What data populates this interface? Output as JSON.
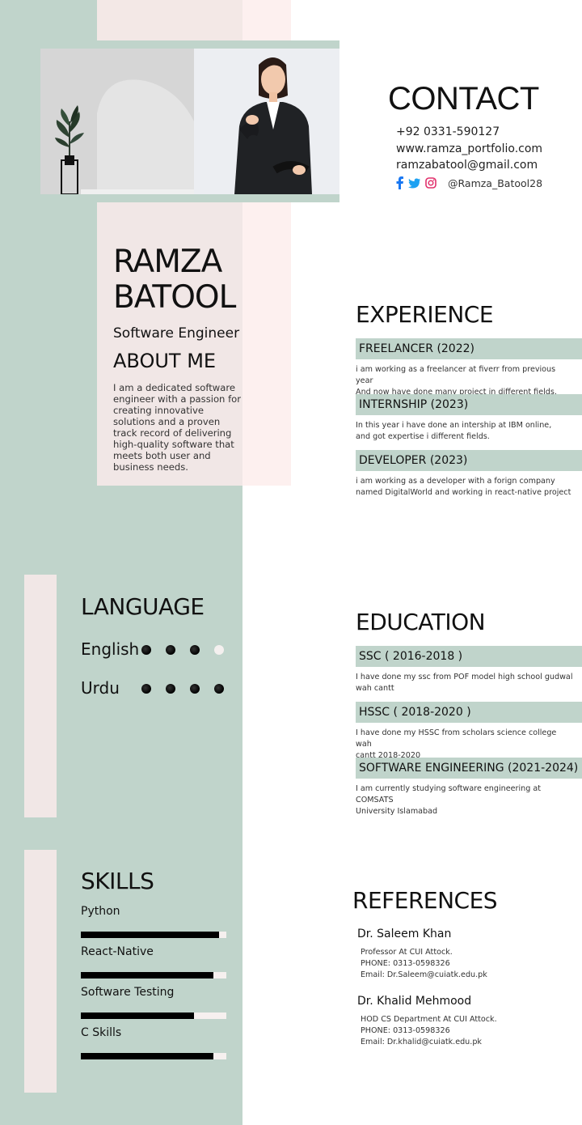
{
  "contact": {
    "title": "CONTACT",
    "phone": "+92 0331-590127",
    "website": "www.ramza_portfolio.com",
    "email": "ramzabatool@gmail.com",
    "social_handle": "@Ramza_Batool28",
    "social_icons": [
      "facebook-icon",
      "twitter-icon",
      "instagram-icon"
    ]
  },
  "profile": {
    "name_line1": "RAMZA",
    "name_line2": "BATOOL",
    "job_title": "Software Engineer",
    "about_title": "ABOUT ME",
    "about_text": "I am a dedicated software engineer with a passion for creating innovative solutions and a proven track record of delivering high-quality software that meets both user and business needs."
  },
  "experience": {
    "title": "EXPERIENCE",
    "items": [
      {
        "heading": "FREELANCER (2022)",
        "line1": "i am working as a freelancer at fiverr from previous year",
        "line2": "And now have done many project in different fields."
      },
      {
        "heading": "INTERNSHIP (2023)",
        "line1": "In this year i have done an intership at IBM online,",
        "line2": "and got expertise i different fields."
      },
      {
        "heading": "DEVELOPER (2023)",
        "line1": "i am working as a developer with a forign company",
        "line2": "named DigitalWorld and working in react-native project"
      }
    ]
  },
  "languages": {
    "title": "LANGUAGE",
    "items": [
      {
        "name": "English",
        "level": 3,
        "max": 4
      },
      {
        "name": "Urdu",
        "level": 4,
        "max": 4
      }
    ]
  },
  "education": {
    "title": "EDUCATION",
    "items": [
      {
        "heading": "SSC  ( 2016-2018 )",
        "line1": "I have done my ssc from POF model high school gudwal",
        "line2": "wah cantt"
      },
      {
        "heading": "HSSC ( 2018-2020 )",
        "line1": "I have done my HSSC from  scholars science college wah",
        "line2": "cantt 2018-2020"
      },
      {
        "heading": "SOFTWARE ENGINEERING (2021-2024)",
        "line1": "I am currently studying software engineering at COMSATS",
        "line2": "University Islamabad"
      }
    ]
  },
  "skills": {
    "title": "SKILLS",
    "items": [
      {
        "name": "Python",
        "level": 0.95
      },
      {
        "name": "React-Native",
        "level": 0.91
      },
      {
        "name": "Software Testing",
        "level": 0.78
      },
      {
        "name": "C Skills",
        "level": 0.91
      }
    ]
  },
  "references": {
    "title": "REFERENCES",
    "items": [
      {
        "name": "Dr. Saleem Khan",
        "role": "Professor At CUI Attock.",
        "phone": "PHONE: 0313-0598326",
        "email": "Email: Dr.Saleem@cuiatk.edu.pk"
      },
      {
        "name": "Dr. Khalid Mehmood",
        "role": "HOD CS Department At CUI Attock.",
        "phone": "PHONE: 0313-0598326",
        "email": "Email: Dr.khalid@cuiatk.edu.pk"
      }
    ]
  },
  "colors": {
    "sage": "#c0d4cb",
    "blush": "#f1e7e6",
    "facebook": "#1877f2",
    "twitter": "#1da1f2",
    "instagram": "#e1306c"
  }
}
